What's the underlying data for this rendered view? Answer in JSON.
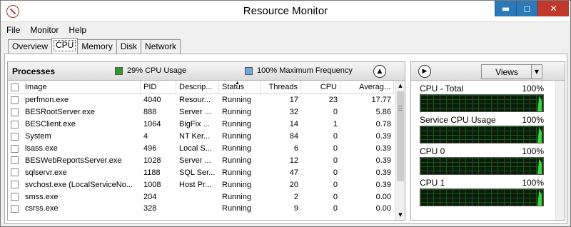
{
  "window": {
    "title": "Resource Monitor",
    "minimize": "▬",
    "maximize": "◻",
    "close": "✕"
  },
  "menu": [
    "File",
    "Monitor",
    "Help"
  ],
  "tabs": [
    {
      "label": "Overview",
      "active": false
    },
    {
      "label": "CPU",
      "active": true
    },
    {
      "label": "Memory",
      "active": false
    },
    {
      "label": "Disk",
      "active": false
    },
    {
      "label": "Network",
      "active": false
    }
  ],
  "processes": {
    "title": "Processes",
    "cpu_usage": "29% CPU Usage",
    "max_freq": "100% Maximum Frequency",
    "colors": {
      "cpu": "#2e9b2e",
      "freq": "#6fa8dc"
    },
    "columns": [
      "Image",
      "PID",
      "Descrip...",
      "Status",
      "Threads",
      "CPU",
      "Averag..."
    ],
    "rows": [
      {
        "image": "perfmon.exe",
        "pid": "4040",
        "desc": "Resour...",
        "status": "Running",
        "threads": "17",
        "cpu": "23",
        "avg": "17.77"
      },
      {
        "image": "BESRootServer.exe",
        "pid": "888",
        "desc": "Server ...",
        "status": "Running",
        "threads": "32",
        "cpu": "0",
        "avg": "5.86"
      },
      {
        "image": "BESClient.exe",
        "pid": "1064",
        "desc": "BigFix ...",
        "status": "Running",
        "threads": "14",
        "cpu": "1",
        "avg": "0.78"
      },
      {
        "image": "System",
        "pid": "4",
        "desc": "NT Ker...",
        "status": "Running",
        "threads": "84",
        "cpu": "0",
        "avg": "0.39"
      },
      {
        "image": "lsass.exe",
        "pid": "496",
        "desc": "Local S...",
        "status": "Running",
        "threads": "6",
        "cpu": "0",
        "avg": "0.39"
      },
      {
        "image": "BESWebReportsServer.exe",
        "pid": "1028",
        "desc": "Server ...",
        "status": "Running",
        "threads": "12",
        "cpu": "0",
        "avg": "0.39"
      },
      {
        "image": "sqlservr.exe",
        "pid": "1188",
        "desc": "SQL Ser...",
        "status": "Running",
        "threads": "47",
        "cpu": "0",
        "avg": "0.39"
      },
      {
        "image": "svchost.exe (LocalServiceNo...",
        "pid": "1008",
        "desc": "Host Pr...",
        "status": "Running",
        "threads": "20",
        "cpu": "0",
        "avg": "0.39"
      },
      {
        "image": "smss.exe",
        "pid": "204",
        "desc": "",
        "status": "Running",
        "threads": "2",
        "cpu": "0",
        "avg": "0.00"
      },
      {
        "image": "csrss.exe",
        "pid": "328",
        "desc": "",
        "status": "Running",
        "threads": "9",
        "cpu": "0",
        "avg": "0.00"
      }
    ]
  },
  "graphs_panel": {
    "views_label": "Views",
    "graphs": [
      {
        "label": "CPU - Total",
        "value": "100%"
      },
      {
        "label": "Service CPU Usage",
        "value": "100%"
      },
      {
        "label": "CPU 0",
        "value": "100%"
      },
      {
        "label": "CPU 1",
        "value": "100%"
      }
    ]
  }
}
